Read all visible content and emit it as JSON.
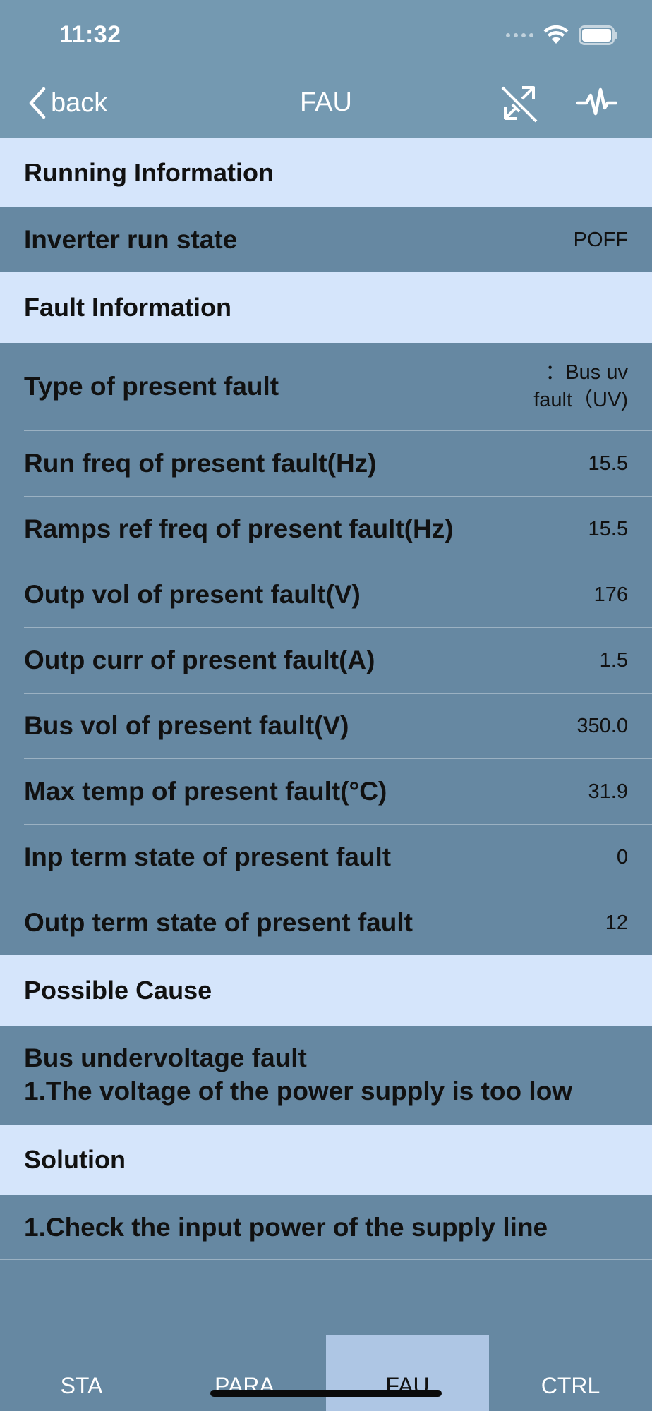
{
  "status_bar": {
    "time": "11:32"
  },
  "nav": {
    "back_label": "back",
    "title": "FAU",
    "icons": [
      "disconnect-icon",
      "waveform-icon"
    ]
  },
  "sections": {
    "running": "Running Information",
    "fault": "Fault Information",
    "cause": "Possible Cause",
    "solution": "Solution"
  },
  "running": {
    "rows": [
      {
        "label": "Inverter run state",
        "value": "POFF"
      }
    ]
  },
  "fault": {
    "type": {
      "label": "Type of present fault",
      "value_line1": "：Bus uv",
      "value_line2": "fault（UV)"
    },
    "rows": [
      {
        "label": "Run freq of present fault(Hz)",
        "value": "15.5"
      },
      {
        "label": "Ramps ref freq of present fault(Hz)",
        "value": "15.5"
      },
      {
        "label": "Outp vol of present fault(V)",
        "value": "176"
      },
      {
        "label": "Outp curr of present fault(A)",
        "value": "1.5"
      },
      {
        "label": "Bus vol of present fault(V)",
        "value": "350.0"
      },
      {
        "label": "Max temp of present fault(°C)",
        "value": "31.9"
      },
      {
        "label": "Inp term state of present fault",
        "value": "0"
      },
      {
        "label": "Outp term state of present fault",
        "value": "12"
      }
    ]
  },
  "cause": {
    "line1": "Bus undervoltage fault",
    "line2": "1.The voltage of the power supply is too low"
  },
  "solution": {
    "line1": "1.Check the input power of the supply line"
  },
  "tabs": [
    {
      "label": "STA",
      "active": false
    },
    {
      "label": "PARA",
      "active": false
    },
    {
      "label": "FAU",
      "active": true
    },
    {
      "label": "CTRL",
      "active": false
    }
  ],
  "colors": {
    "background": "#6688a2",
    "header": "#7499b1",
    "section": "#d5e5fb",
    "active_tab": "#aec6e4"
  }
}
